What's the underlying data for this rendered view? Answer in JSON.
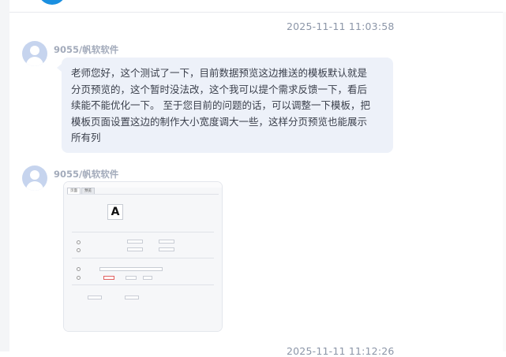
{
  "messages": [
    {
      "timestamp": "2025-11-11 11:03:58",
      "sender": "9055/帆软软件",
      "text_lines": [
        "老师您好，这个测试了一下，目前数据预览这边推送的模板默认就是",
        "分页预览的，这个暂时没法改，这个我可以提个需求反馈一下，看后",
        "续能不能优化一下。 至于您目前的问题的话，可以调整一下模板，把",
        "模板页面设置这边的制作大小宽度调大一些，这样分页预览也能展示",
        "所有列"
      ]
    },
    {
      "sender": "9055/帆软软件",
      "image": {
        "tabs": [
          "页面",
          "预览"
        ],
        "preview_letter": "A"
      }
    },
    {
      "timestamp": "2025-11-11 11:12:26"
    }
  ],
  "colors": {
    "bubble": "#edf1f9",
    "timestamp": "#8c96a8",
    "sender": "#a3abbb",
    "accent": "#1a8fe0"
  }
}
